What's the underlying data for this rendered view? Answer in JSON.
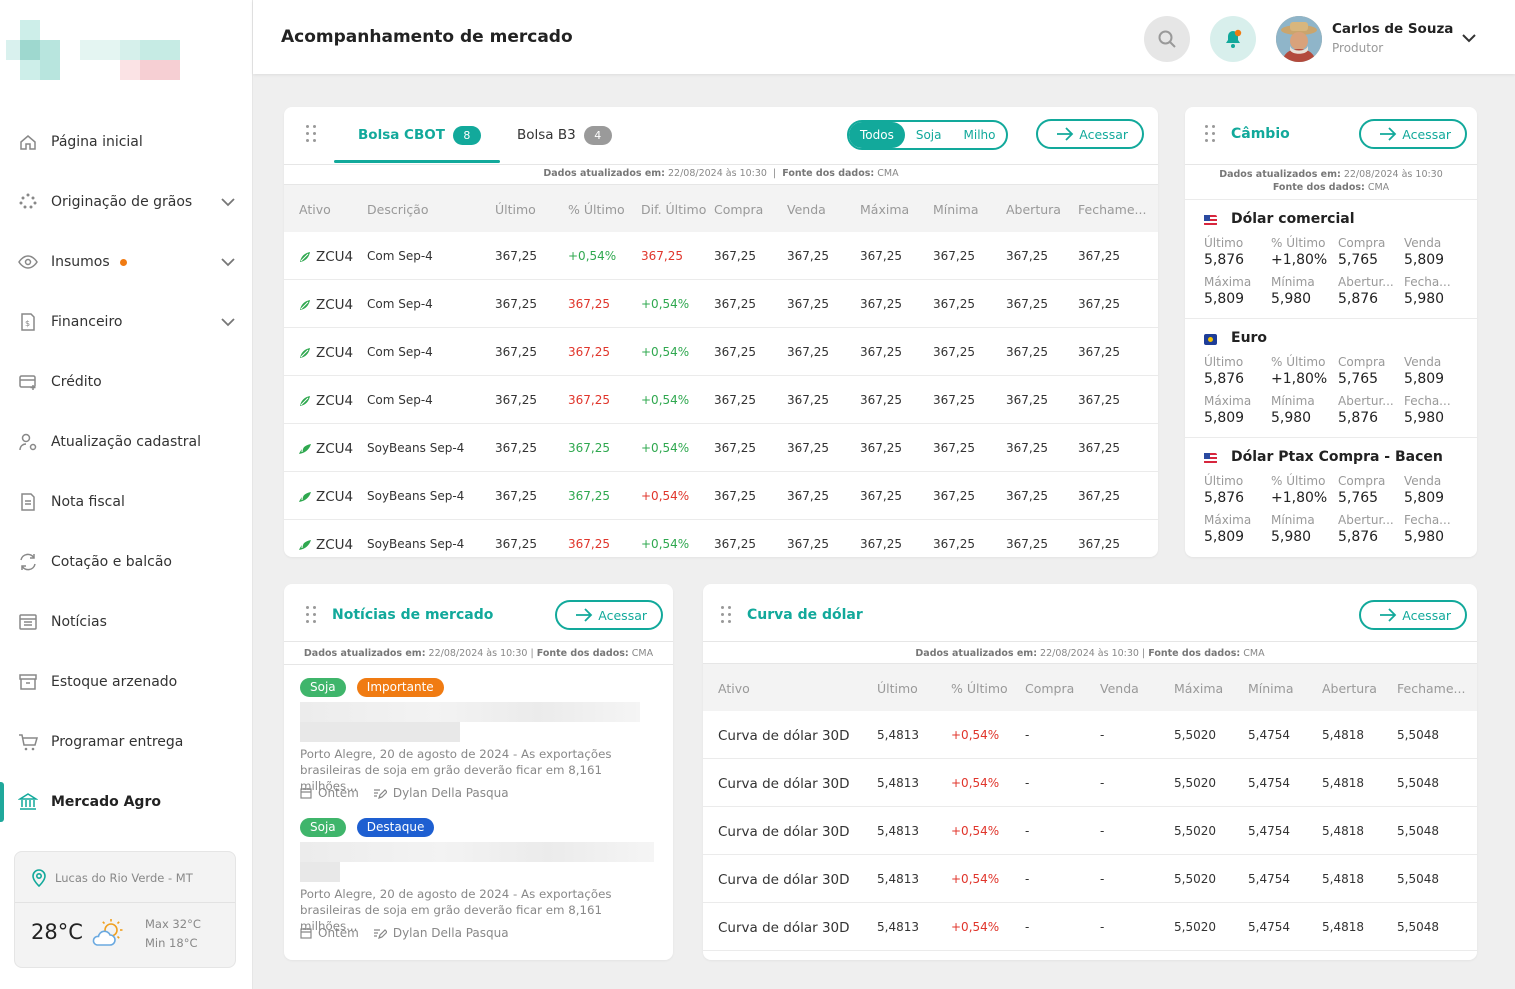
{
  "header": {
    "title": "Acompanhamento de mercado",
    "user_name": "Carlos de Souza",
    "user_role": "Produtor"
  },
  "sidebar": {
    "items": [
      {
        "label": "Página inicial",
        "icon": "home-icon"
      },
      {
        "label": "Originação de grãos",
        "icon": "grain-icon",
        "expandable": true
      },
      {
        "label": "Insumos",
        "icon": "eye-icon",
        "expandable": true,
        "dot": true
      },
      {
        "label": "Financeiro",
        "icon": "finance-doc-icon",
        "expandable": true
      },
      {
        "label": "Crédito",
        "icon": "credit-card-icon"
      },
      {
        "label": "Atualização cadastral",
        "icon": "user-settings-icon"
      },
      {
        "label": "Nota fiscal",
        "icon": "invoice-icon"
      },
      {
        "label": "Cotação e balcão",
        "icon": "exchange-icon"
      },
      {
        "label": "Notícias",
        "icon": "news-icon"
      },
      {
        "label": "Estoque arzenado",
        "icon": "storage-icon"
      },
      {
        "label": "Programar entrega",
        "icon": "cart-icon"
      },
      {
        "label": "Mercado Agro",
        "icon": "bank-icon",
        "active": true
      }
    ],
    "weather": {
      "location": "Lucas do Rio Verde - MT",
      "temp": "28°C",
      "max": "Max 32°C",
      "min": "Min 18°C"
    }
  },
  "bolsa": {
    "tabs": [
      {
        "label": "Bolsa CBOT",
        "count": "8"
      },
      {
        "label": "Bolsa B3",
        "count": "4"
      }
    ],
    "filters": [
      "Todos",
      "Soja",
      "Milho"
    ],
    "access": "Acessar",
    "updated_label": "Dados atualizados em:",
    "updated_value": "22/08/2024 às 10:30",
    "source_label": "Fonte dos dados:",
    "source_value": "CMA",
    "columns": [
      "Ativo",
      "Descrição",
      "Último",
      "% Último",
      "Dif. Último",
      "Compra",
      "Venda",
      "Máxima",
      "Mínima",
      "Abertura",
      "Fechame..."
    ],
    "rows": [
      {
        "ativo": "ZCU4",
        "desc": "Com Sep-4",
        "ultimo": "367,25",
        "pct": "+0,54%",
        "pct_c": "green",
        "dif": "367,25",
        "dif_c": "red",
        "compra": "367,25",
        "venda": "367,25",
        "max": "367,25",
        "min": "367,25",
        "abert": "367,25",
        "fech": "367,25",
        "type": "corn"
      },
      {
        "ativo": "ZCU4",
        "desc": "Com Sep-4",
        "ultimo": "367,25",
        "pct": "367,25",
        "pct_c": "red",
        "dif": "+0,54%",
        "dif_c": "green",
        "compra": "367,25",
        "venda": "367,25",
        "max": "367,25",
        "min": "367,25",
        "abert": "367,25",
        "fech": "367,25",
        "type": "corn"
      },
      {
        "ativo": "ZCU4",
        "desc": "Com Sep-4",
        "ultimo": "367,25",
        "pct": "367,25",
        "pct_c": "red",
        "dif": "+0,54%",
        "dif_c": "green",
        "compra": "367,25",
        "venda": "367,25",
        "max": "367,25",
        "min": "367,25",
        "abert": "367,25",
        "fech": "367,25",
        "type": "corn"
      },
      {
        "ativo": "ZCU4",
        "desc": "Com Sep-4",
        "ultimo": "367,25",
        "pct": "367,25",
        "pct_c": "red",
        "dif": "+0,54%",
        "dif_c": "green",
        "compra": "367,25",
        "venda": "367,25",
        "max": "367,25",
        "min": "367,25",
        "abert": "367,25",
        "fech": "367,25",
        "type": "corn"
      },
      {
        "ativo": "ZCU4",
        "desc": "SoyBeans Sep-4",
        "ultimo": "367,25",
        "pct": "367,25",
        "pct_c": "green",
        "dif": "+0,54%",
        "dif_c": "green",
        "compra": "367,25",
        "venda": "367,25",
        "max": "367,25",
        "min": "367,25",
        "abert": "367,25",
        "fech": "367,25",
        "type": "soy"
      },
      {
        "ativo": "ZCU4",
        "desc": "SoyBeans Sep-4",
        "ultimo": "367,25",
        "pct": "367,25",
        "pct_c": "green",
        "dif": "+0,54%",
        "dif_c": "red",
        "compra": "367,25",
        "venda": "367,25",
        "max": "367,25",
        "min": "367,25",
        "abert": "367,25",
        "fech": "367,25",
        "type": "soy"
      },
      {
        "ativo": "ZCU4",
        "desc": "SoyBeans Sep-4",
        "ultimo": "367,25",
        "pct": "367,25",
        "pct_c": "red",
        "dif": "+0,54%",
        "dif_c": "green",
        "compra": "367,25",
        "venda": "367,25",
        "max": "367,25",
        "min": "367,25",
        "abert": "367,25",
        "fech": "367,25",
        "type": "soy"
      }
    ]
  },
  "cambio": {
    "title": "Câmbio",
    "access": "Acessar",
    "updated_label": "Dados atualizados em:",
    "updated_value": "22/08/2024 às 10:30",
    "source_label": "Fonte dos dados:",
    "source_value": "CMA",
    "labels": [
      "Último",
      "% Último",
      "Compra",
      "Venda",
      "Máxima",
      "Mínima",
      "Abertur...",
      "Fecha..."
    ],
    "currencies": [
      {
        "name": "Dólar comercial",
        "flag": "us",
        "values": [
          "5,876",
          "+1,80%",
          "5,765",
          "5,809",
          "5,809",
          "5,980",
          "5,876",
          "5,980"
        ]
      },
      {
        "name": "Euro",
        "flag": "eu",
        "values": [
          "5,876",
          "+1,80%",
          "5,765",
          "5,809",
          "5,809",
          "5,980",
          "5,876",
          "5,980"
        ]
      },
      {
        "name": "Dólar Ptax Compra - Bacen",
        "flag": "us",
        "values": [
          "5,876",
          "+1,80%",
          "5,765",
          "5,809",
          "5,809",
          "5,980",
          "5,876",
          "5,980"
        ]
      }
    ]
  },
  "news": {
    "title": "Notícias de mercado",
    "access": "Acessar",
    "updated_label": "Dados atualizados em:",
    "updated_value": "22/08/2024 às 10:30",
    "source_label": "Fonte dos dados:",
    "source_value": "CMA",
    "items": [
      {
        "tags": [
          {
            "label": "Soja",
            "color": "#3fb56b"
          },
          {
            "label": "Importante",
            "color": "#f07b12"
          }
        ],
        "text": "Porto Alegre, 20 de agosto de 2024 - As exportações brasileiras de soja em grão deverão ficar em 8,161 milhões...",
        "date": "Ontem",
        "author": "Dylan Della Pasqua"
      },
      {
        "tags": [
          {
            "label": "Soja",
            "color": "#3fb56b"
          },
          {
            "label": "Destaque",
            "color": "#1e5fd1"
          }
        ],
        "text": "Porto Alegre, 20 de agosto de 2024 - As exportações brasileiras de soja em grão deverão ficar em 8,161 milhões...",
        "date": "Ontem",
        "author": "Dylan Della Pasqua"
      }
    ]
  },
  "curva": {
    "title": "Curva de dólar",
    "access": "Acessar",
    "updated_label": "Dados atualizados em:",
    "updated_value": "22/08/2024 às 10:30",
    "source_label": "Fonte dos dados:",
    "source_value": "CMA",
    "columns": [
      "Ativo",
      "Último",
      "% Último",
      "Compra",
      "Venda",
      "Máxima",
      "Mínima",
      "Abertura",
      "Fechame..."
    ],
    "rows": [
      [
        "Curva de dólar 30D",
        "5,4813",
        "+0,54%",
        "-",
        "-",
        "5,5020",
        "5,4754",
        "5,4818",
        "5,5048"
      ],
      [
        "Curva de dólar 30D",
        "5,4813",
        "+0,54%",
        "-",
        "-",
        "5,5020",
        "5,4754",
        "5,4818",
        "5,5048"
      ],
      [
        "Curva de dólar 30D",
        "5,4813",
        "+0,54%",
        "-",
        "-",
        "5,5020",
        "5,4754",
        "5,4818",
        "5,5048"
      ],
      [
        "Curva de dólar 30D",
        "5,4813",
        "+0,54%",
        "-",
        "-",
        "5,5020",
        "5,4754",
        "5,4818",
        "5,5048"
      ],
      [
        "Curva de dólar 30D",
        "5,4813",
        "+0,54%",
        "-",
        "-",
        "5,5020",
        "5,4754",
        "5,4818",
        "5,5048"
      ]
    ]
  },
  "colors": {
    "accent": "#12a99b",
    "green": "#2fa84f",
    "red": "#e0352b",
    "orange": "#f07b12"
  }
}
